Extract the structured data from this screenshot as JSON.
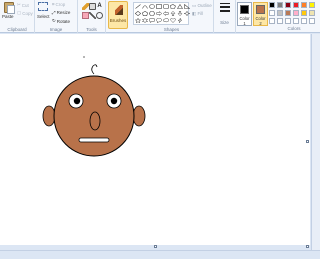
{
  "ribbon": {
    "clipboard": {
      "label": "Clipboard",
      "paste": "Paste",
      "cut": "Cut",
      "copy": "Copy"
    },
    "image": {
      "label": "Image",
      "select": "Select",
      "crop": "Crop",
      "resize": "Resize",
      "rotate": "Rotate"
    },
    "tools": {
      "label": "Tools"
    },
    "brushes": {
      "label": "Brushes"
    },
    "shapes": {
      "label": "Shapes",
      "outline": "Outline",
      "fill": "Fill"
    },
    "size": {
      "label": "Size"
    },
    "colors": {
      "label": "Colors",
      "color1_label": "Color 1",
      "color2_label": "Color 2",
      "color1": "#000000",
      "color2": "#b8724a",
      "palette": [
        "#000000",
        "#7f7f7f",
        "#880015",
        "#ed1c24",
        "#ff7f27",
        "#fff200",
        "#ffffff",
        "#c3c3c3",
        "#b97a57",
        "#ffaec9",
        "#ffc90e",
        "#efe4b0",
        "#ffffff",
        "#ffffff",
        "#ffffff",
        "#ffffff",
        "#ffffff",
        "#ffffff"
      ]
    }
  },
  "drawing": {
    "face_color": "#b8724a",
    "ear_color": "#b8724a",
    "nose_color": "#b8724a",
    "outline_color": "#000000",
    "eye_white": "#ffffff",
    "pupil_color": "#000000"
  }
}
